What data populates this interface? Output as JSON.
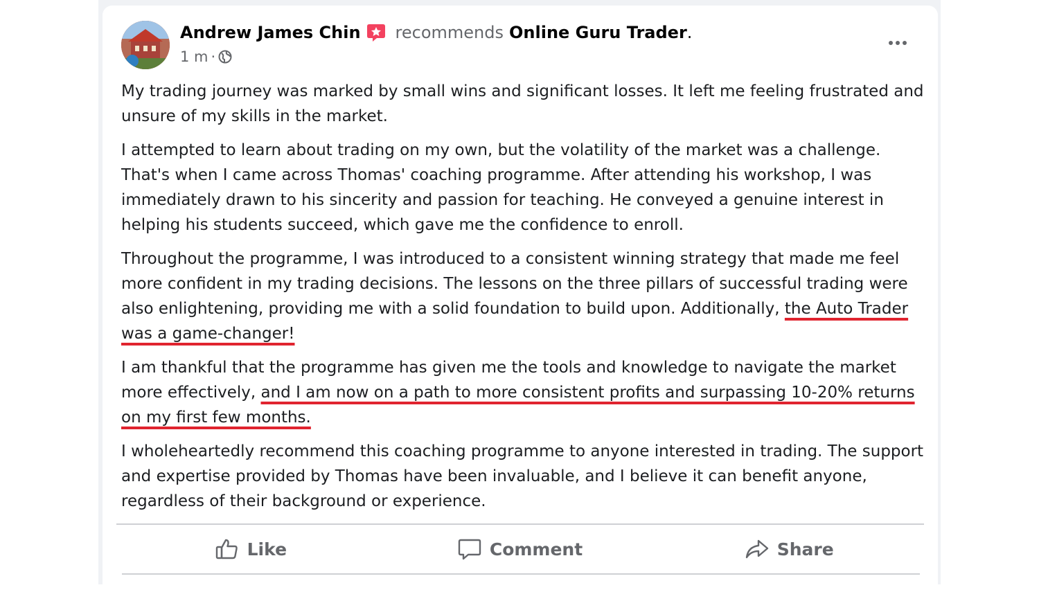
{
  "post": {
    "author": "Andrew James Chin",
    "recommends_text": "recommends",
    "page_name": "Online Guru Trader",
    "page_name_suffix": ".",
    "time": "1 m",
    "meta_separator": "·",
    "privacy_icon": "globe-icon",
    "badge_icon": "recommend-badge-icon",
    "more_icon": "more-options-icon"
  },
  "body": {
    "p1": "My trading journey was marked by small wins and significant losses. It left me feeling frustrated and unsure of my skills in the market.",
    "p2": "I attempted to learn about trading on my own, but the volatility of the market was a challenge. That's when I came across Thomas' coaching programme. After attending his workshop, I was immediately drawn to his sincerity and passion for teaching. He conveyed a genuine interest in helping his students succeed, which gave me the confidence to enroll.",
    "p3_plain": "Throughout the programme, I was introduced to a consistent winning strategy that made me feel more confident in my trading decisions. The lessons on the three pillars of successful trading were also enlightening, providing me with a solid foundation to build upon. Additionally, ",
    "p3_highlight": "the Auto Trader was a game-changer!",
    "p4_plain": "I am thankful that the programme has given me the tools and knowledge to navigate the market more effectively, ",
    "p4_highlight": "and I am now on a path to more consistent profits and surpassing 10-20% returns on my first few months.",
    "p5": "I wholeheartedly recommend this coaching programme to anyone interested in trading. The support and expertise provided by Thomas have been invaluable, and I believe it can benefit anyone, regardless of their background or experience."
  },
  "actions": {
    "like": "Like",
    "comment": "Comment",
    "share": "Share"
  },
  "colors": {
    "underline": "#e0242f",
    "badge": "#f3425f",
    "secondary_text": "#65676b"
  }
}
